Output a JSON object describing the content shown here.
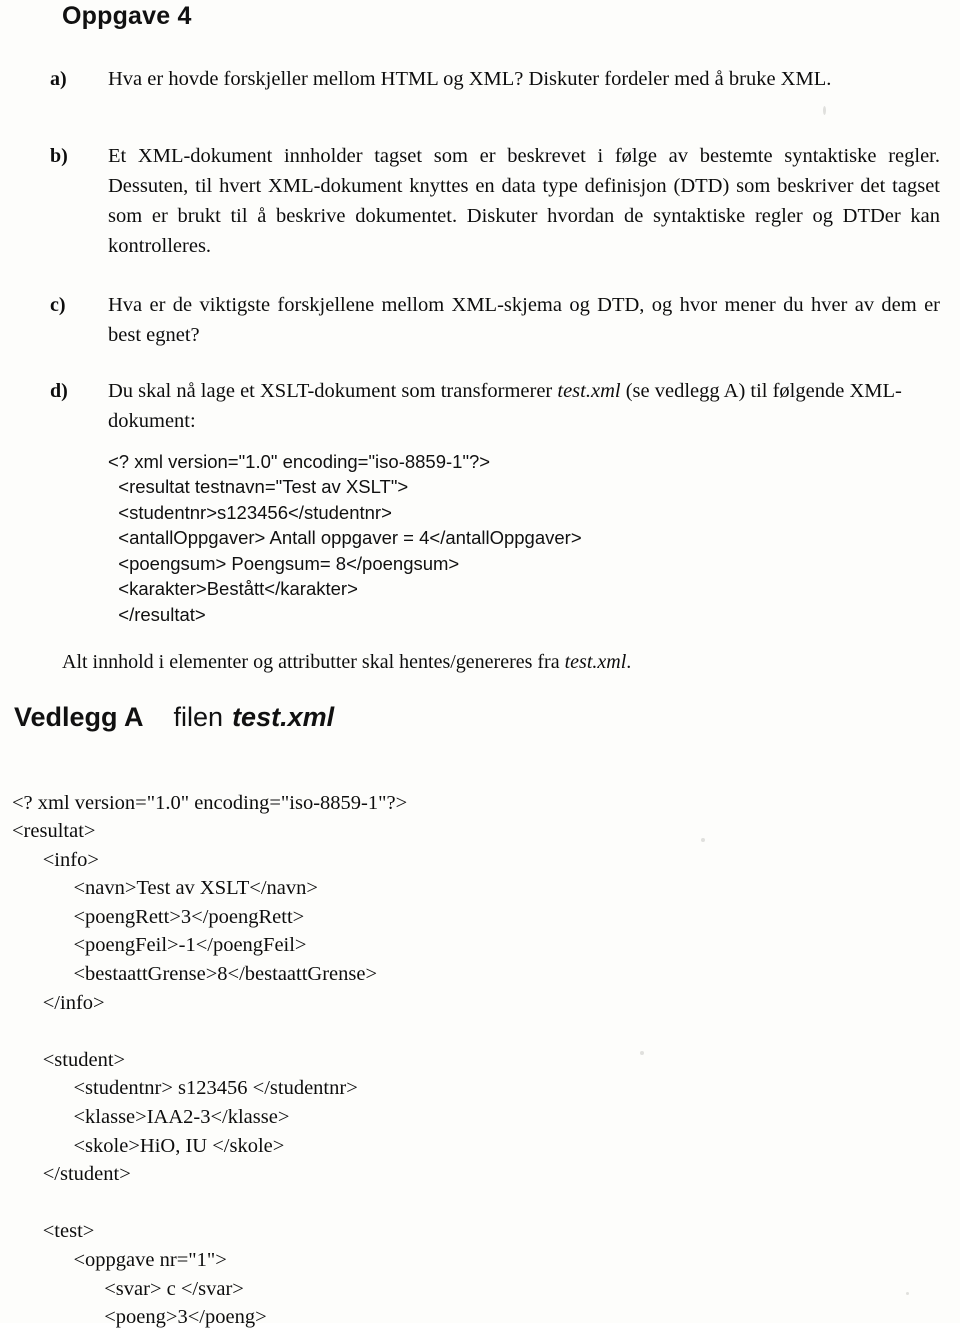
{
  "document": {
    "title": "Oppgave 4"
  },
  "tasks": [
    {
      "marker": "a)",
      "text": "Hva er hovde forskjeller mellom HTML og XML? Diskuter fordeler med å bruke XML."
    },
    {
      "marker": "b)",
      "text": "Et XML-dokument innholder tagset som er beskrevet i følge av bestemte syntaktiske regler. Dessuten, til hvert XML-dokument knyttes en data type definisjon (DTD) som beskriver det tagset som er brukt til å beskrive dokumentet. Diskuter hvordan de syntaktiske regler og DTDer kan kontrolleres."
    },
    {
      "marker": "c)",
      "text": "Hva er de viktigste forskjellene mellom XML-skjema og DTD, og hvor mener du hver av dem er best egnet?"
    },
    {
      "marker": "d)",
      "text_before_italic": "Du skal nå lage et XSLT-dokument som transformerer ",
      "italic": "test.xml",
      "text_after_italic": " (se vedlegg A) til følgende XML-dokument:"
    }
  ],
  "target_xml_listing": "<? xml version=\"1.0\" encoding=\"iso-8859-1\"?>\n  <resultat testnavn=\"Test av XSLT\">\n  <studentnr>s123456</studentnr>\n  <antallOppgaver> Antall oppgaver = 4</antallOppgaver>\n  <poengsum> Poengsum= 8</poengsum>\n  <karakter>Bestått</karakter>\n  </resultat>",
  "note": {
    "before_italic": "Alt innhold i elementer og attributter skal hentes/genereres fra ",
    "italic": "test.xml",
    "after_italic": "."
  },
  "appendix_heading": {
    "label": "Vedlegg A",
    "filen": "filen",
    "file": "test.xml"
  },
  "appendix_xml_listing": "<? xml version=\"1.0\" encoding=\"iso-8859-1\"?>\n<resultat>\n      <info>\n            <navn>Test av XSLT</navn>\n            <poengRett>3</poengRett>\n            <poengFeil>-1</poengFeil>\n            <bestaattGrense>8</bestaattGrense>\n      </info>\n\n      <student>\n            <studentnr> s123456 </studentnr>\n            <klasse>IAA2-3</klasse>\n            <skole>HiO, IU </skole>\n      </student>\n\n      <test>\n            <oppgave nr=\"1\">\n                  <svar> c </svar>\n                  <poeng>3</poeng>"
}
